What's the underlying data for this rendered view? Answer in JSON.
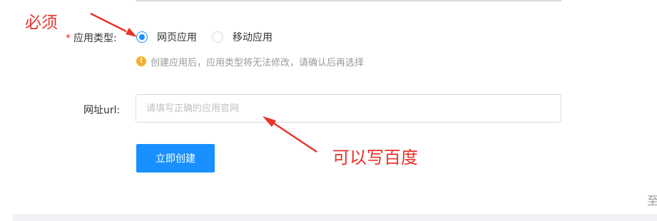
{
  "form": {
    "app_type": {
      "required_mark": "*",
      "label": "应用类型:",
      "options": [
        {
          "label": "网页应用",
          "checked": true
        },
        {
          "label": "移动应用",
          "checked": false
        }
      ],
      "hint_icon": "warning-icon",
      "hint_icon_glyph": "!",
      "hint": "创建应用后，应用类型将无法修改，请确认后再选择"
    },
    "url": {
      "label": "网址url:",
      "placeholder": "请填写正确的应用官网",
      "value": ""
    },
    "submit_label": "立即创建"
  },
  "annotations": {
    "required_note": "必须",
    "url_note": "可以写百度",
    "color": "#e8332b"
  },
  "edge_text": "至",
  "colors": {
    "primary": "#1890ff",
    "warning": "#f5b031",
    "required": "#f5222d"
  }
}
